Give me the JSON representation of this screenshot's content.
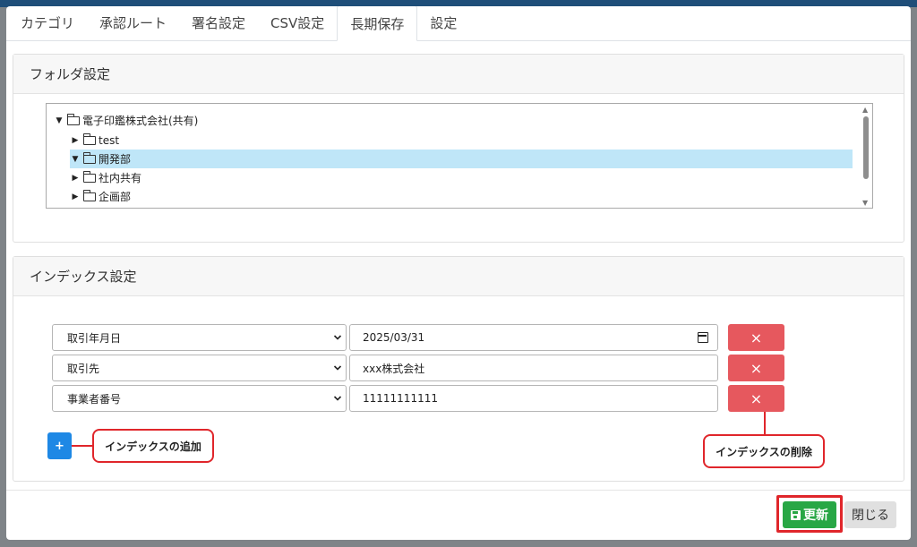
{
  "tabs": [
    {
      "label": "カテゴリ"
    },
    {
      "label": "承認ルート"
    },
    {
      "label": "署名設定"
    },
    {
      "label": "CSV設定"
    },
    {
      "label": "長期保存"
    },
    {
      "label": "設定"
    }
  ],
  "active_tab": "長期保存",
  "folder_section": {
    "title": "フォルダ設定",
    "tree": [
      {
        "label": "電子印鑑株式会社(共有)",
        "expanded": true,
        "selected": false
      },
      {
        "label": "test",
        "expanded": false,
        "selected": false
      },
      {
        "label": "開発部",
        "expanded": true,
        "selected": true
      },
      {
        "label": "社内共有",
        "expanded": false,
        "selected": false
      },
      {
        "label": "企画部",
        "expanded": false,
        "selected": false
      }
    ]
  },
  "index_section": {
    "title": "インデックス設定",
    "rows": [
      {
        "field": "取引年月日",
        "value": "2025/03/31"
      },
      {
        "field": "取引先",
        "value": "xxx株式会社"
      },
      {
        "field": "事業者番号",
        "value": "11111111111"
      }
    ],
    "delete_label": "×",
    "add_label": "+"
  },
  "annotations": {
    "add": "インデックスの追加",
    "delete": "インデックスの削除"
  },
  "footer": {
    "update_label": "更新",
    "close_label": "閉じる"
  },
  "colors": {
    "update": "#28a745",
    "delete": "#e6585e",
    "add": "#1e88e5",
    "annotation": "#e0262b",
    "selected_row": "#bfe6f8"
  }
}
